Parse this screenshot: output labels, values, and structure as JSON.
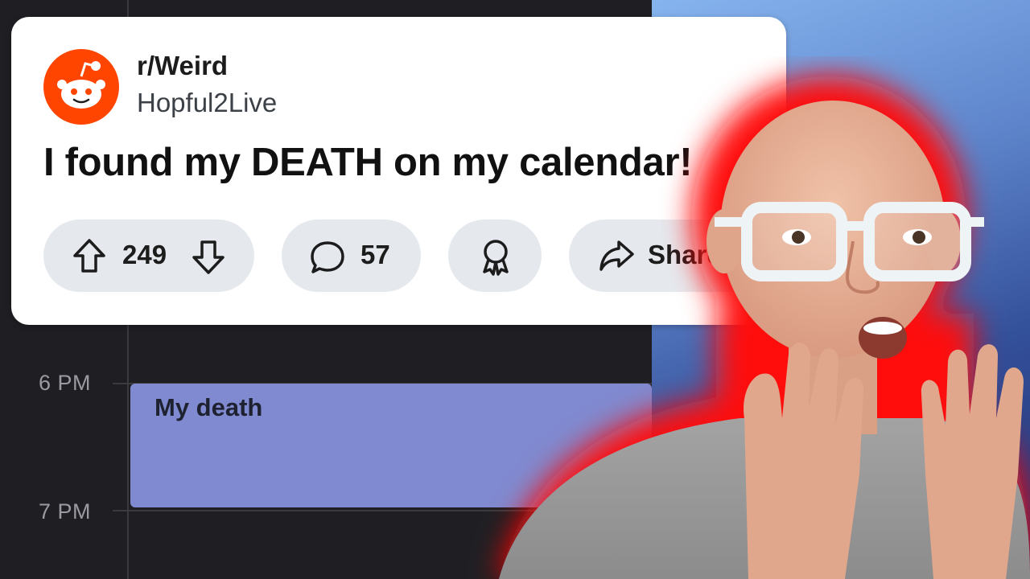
{
  "calendar": {
    "times": [
      "6 PM",
      "7 PM"
    ],
    "event_title": "My death"
  },
  "post": {
    "subreddit": "r/Weird",
    "username": "Hopful2Live",
    "title": "I found my DEATH on my calendar!",
    "votes": "249",
    "comments": "57",
    "share_label": "Share"
  },
  "colors": {
    "reddit_orange": "#ff4500",
    "event_purple": "#7f8ad0",
    "glow_red": "#ff1a1a"
  }
}
